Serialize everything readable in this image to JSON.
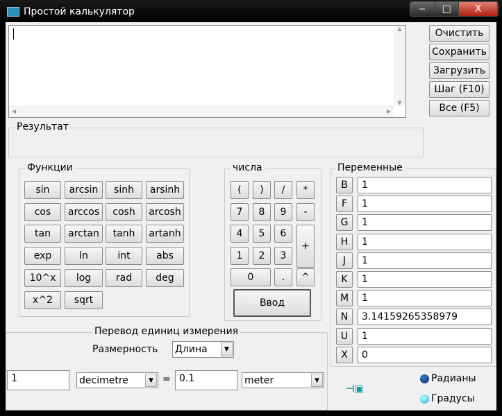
{
  "window": {
    "title": "Простой калькулятор",
    "minimize": "‒",
    "maximize": "□",
    "close": "X"
  },
  "editor": {
    "value": ""
  },
  "side_buttons": [
    "Очистить",
    "Сохранить",
    "Загрузить",
    "Шаг (F10)",
    "Все (F5)"
  ],
  "result": {
    "label": "Результат",
    "value": ""
  },
  "functions": {
    "label": "Функции",
    "buttons": [
      [
        "sin",
        "arcsin",
        "sinh",
        "arsinh"
      ],
      [
        "cos",
        "arccos",
        "cosh",
        "arcosh"
      ],
      [
        "tan",
        "arctan",
        "tanh",
        "artanh"
      ],
      [
        "exp",
        "ln",
        "int",
        "abs"
      ],
      [
        "10^x",
        "log",
        "rad",
        "deg"
      ],
      [
        "x^2",
        "sqrt"
      ]
    ]
  },
  "numbers": {
    "label": "числа",
    "row1": [
      "(",
      ")",
      "/",
      "*"
    ],
    "row2": [
      "7",
      "8",
      "9",
      "-"
    ],
    "row3": [
      "4",
      "5",
      "6"
    ],
    "row4": [
      "1",
      "2",
      "3"
    ],
    "plus": "+",
    "zero": "0",
    "dot": ".",
    "pow": "^",
    "enter": "Ввод"
  },
  "variables": {
    "label": "Переменные",
    "items": [
      {
        "name": "B",
        "value": "1"
      },
      {
        "name": "F",
        "value": "1"
      },
      {
        "name": "G",
        "value": "1"
      },
      {
        "name": "H",
        "value": "1"
      },
      {
        "name": "J",
        "value": "1"
      },
      {
        "name": "K",
        "value": "1"
      },
      {
        "name": "M",
        "value": "1"
      },
      {
        "name": "N",
        "value": "3.14159265358979"
      },
      {
        "name": "U",
        "value": "1"
      },
      {
        "name": "X",
        "value": "0"
      }
    ]
  },
  "conversion": {
    "label": "Перевод единиц измерения",
    "dimension_label": "Размерность",
    "dimension": "Длина",
    "input_value": "1",
    "from_unit": "decimetre",
    "equals": "=",
    "output_value": "0.1",
    "to_unit": "meter"
  },
  "angle": {
    "radians": "Радианы",
    "degrees": "Градусы",
    "selected": "radians"
  }
}
